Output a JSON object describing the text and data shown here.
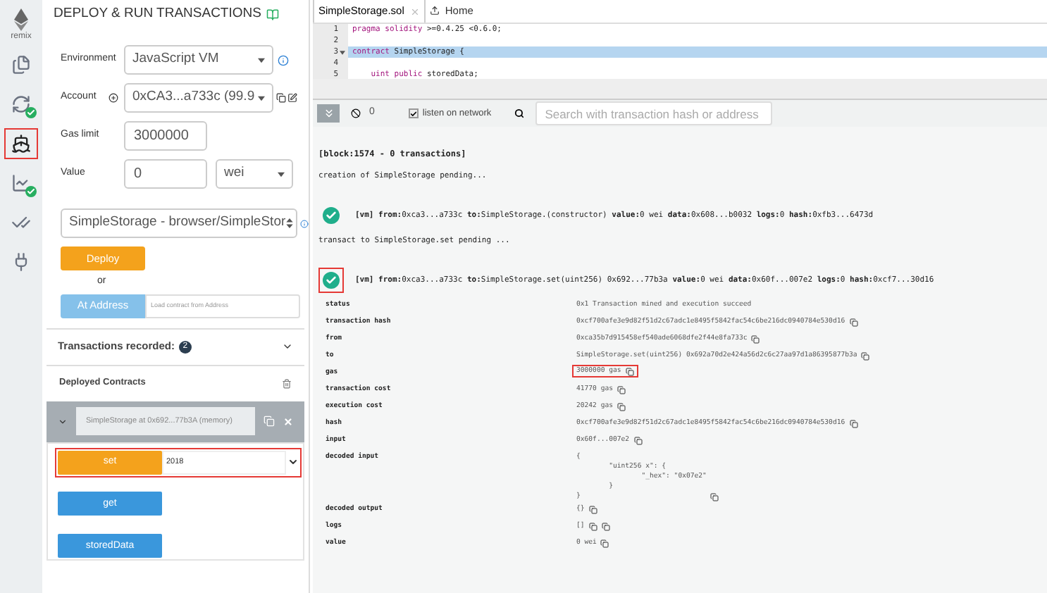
{
  "icon_bar": {
    "logo_text": "remix",
    "items": [
      {
        "kind": "files",
        "badge": false,
        "highlighted": false
      },
      {
        "kind": "compile",
        "badge": true,
        "highlighted": false
      },
      {
        "kind": "deploy",
        "badge": false,
        "highlighted": true
      },
      {
        "kind": "analysis",
        "badge": true,
        "highlighted": false
      },
      {
        "kind": "tests",
        "badge": false,
        "highlighted": false
      },
      {
        "kind": "plugin",
        "badge": false,
        "highlighted": false
      }
    ]
  },
  "deploy_panel": {
    "title": "DEPLOY & RUN TRANSACTIONS",
    "environment": {
      "label": "Environment",
      "value": "JavaScript VM"
    },
    "account": {
      "label": "Account",
      "value": "0xCA3...a733c (99.9"
    },
    "gas_limit": {
      "label": "Gas limit",
      "value": "3000000"
    },
    "value": {
      "label": "Value",
      "value": "0",
      "unit": "wei"
    },
    "contract": {
      "value": "SimpleStorage - browser/SimpleStor"
    },
    "deploy_button": "Deploy",
    "or_text": "or",
    "at_address": {
      "button": "At Address",
      "placeholder": "Load contract from Address"
    },
    "transactions_recorded": {
      "label": "Transactions recorded:",
      "count": "2"
    },
    "deployed_contracts": {
      "title": "Deployed Contracts",
      "instance": {
        "label": "SimpleStorage at 0x692...77b3A (memory)",
        "expanded": true,
        "functions": [
          {
            "kind": "transact",
            "label": "set",
            "value": "2018",
            "highlighted": true
          },
          {
            "kind": "call",
            "label": "get",
            "highlighted": false
          },
          {
            "kind": "call",
            "label": "storedData",
            "highlighted": false
          }
        ]
      }
    }
  },
  "editor": {
    "tabs": [
      {
        "label": "SimpleStorage.sol",
        "selected": true,
        "closable": true
      },
      {
        "label": "Home",
        "selected": false,
        "closable": false
      }
    ],
    "lines": [
      {
        "number": "1",
        "fold": false,
        "active": false,
        "tokens": [
          {
            "kind": "keyword",
            "text": "pragma solidity"
          },
          {
            "kind": "plain",
            "text": " >=0.4.25 <0.6.0;"
          }
        ]
      },
      {
        "number": "2",
        "fold": false,
        "active": false
      },
      {
        "number": "3",
        "fold": true,
        "active": true,
        "tokens": [
          {
            "kind": "keyword",
            "text": "contract"
          },
          {
            "kind": "plain",
            "text": " SimpleStorage {"
          }
        ]
      },
      {
        "number": "4",
        "fold": false,
        "active": false
      },
      {
        "number": "5",
        "fold": false,
        "active": false,
        "tokens": [
          {
            "kind": "keyword",
            "text": "    uint public"
          },
          {
            "kind": "plain",
            "text": " storedData;"
          }
        ]
      }
    ]
  },
  "terminal": {
    "pending_count": "0",
    "listen": {
      "label": "listen on network",
      "checked": true
    },
    "search": {
      "placeholder": "Search with transaction hash or address"
    },
    "log": [
      {
        "kind": "block",
        "text": "[block:1574 -  0 transactions]"
      },
      {
        "kind": "info",
        "text": "creation of SimpleStorage pending..."
      },
      {
        "kind": "tx",
        "highlighted": false,
        "text": "**[vm]  from:**0xca3...a733c **to:**SimpleStorage.(constructor) **value:**0 wei **data:**0x608...b0032 **logs:**0 **hash:**0xfb3...6473d"
      },
      {
        "kind": "info",
        "text": "transact to SimpleStorage.set pending ..."
      },
      {
        "kind": "tx",
        "highlighted": true,
        "text": "**[vm]  from:**0xca3...a733c **to:**SimpleStorage.set(uint256) 0x692...77b3a **value:**0 wei **data:**0x60f...007e2 **logs:**0 **hash:**0xcf7...30d16"
      }
    ],
    "details": [
      {
        "label": "status",
        "value": [
          "0x1 Transaction mined and execution succeed"
        ],
        "kind": "plain",
        "highlighted": false
      },
      {
        "label": "transaction hash",
        "value": [
          "0xcf700afe3e9d82f51d2c67adc1e8495f5842fac54c6be216dc0940784e530d16"
        ],
        "kind": "copyable",
        "highlighted": false
      },
      {
        "label": "from",
        "value": [
          "0xca35b7d915458ef540ade6068dfe2f44e8fa733c"
        ],
        "kind": "copyable",
        "highlighted": false
      },
      {
        "label": "to",
        "value": [
          "SimpleStorage.set(uint256) 0x692a70d2e424a56d2c6c27aa97d1a86395877b3a"
        ],
        "kind": "copyable",
        "highlighted": false
      },
      {
        "label": "gas",
        "value": [
          "3000000 gas"
        ],
        "kind": "copyable",
        "highlighted": true
      },
      {
        "label": "transaction cost",
        "value": [
          "41770 gas"
        ],
        "kind": "copyable",
        "highlighted": false
      },
      {
        "label": "execution cost",
        "value": [
          "20242 gas"
        ],
        "kind": "copyable",
        "highlighted": false
      },
      {
        "label": "hash",
        "value": [
          "0xcf700afe3e9d82f51d2c67adc1e8495f5842fac54c6be216dc0940784e530d16"
        ],
        "kind": "copyable",
        "highlighted": false
      },
      {
        "label": "input",
        "value": [
          "0x60f...007e2"
        ],
        "kind": "copyable",
        "highlighted": false
      },
      {
        "label": "decoded input",
        "value": [
          "{",
          "        \"uint256 x\": {",
          "                \"_hex\": \"0x07e2\"",
          "        }",
          "}"
        ],
        "kind": "copyable",
        "highlighted": false
      },
      {
        "label": "decoded output",
        "value": [
          "{}"
        ],
        "kind": "copyable",
        "highlighted": false
      },
      {
        "label": "logs",
        "value": [
          "[]"
        ],
        "kind": "copyable_twice",
        "highlighted": false
      },
      {
        "label": "value",
        "value": [
          "0 wei"
        ],
        "kind": "copyable",
        "highlighted": false
      }
    ]
  }
}
